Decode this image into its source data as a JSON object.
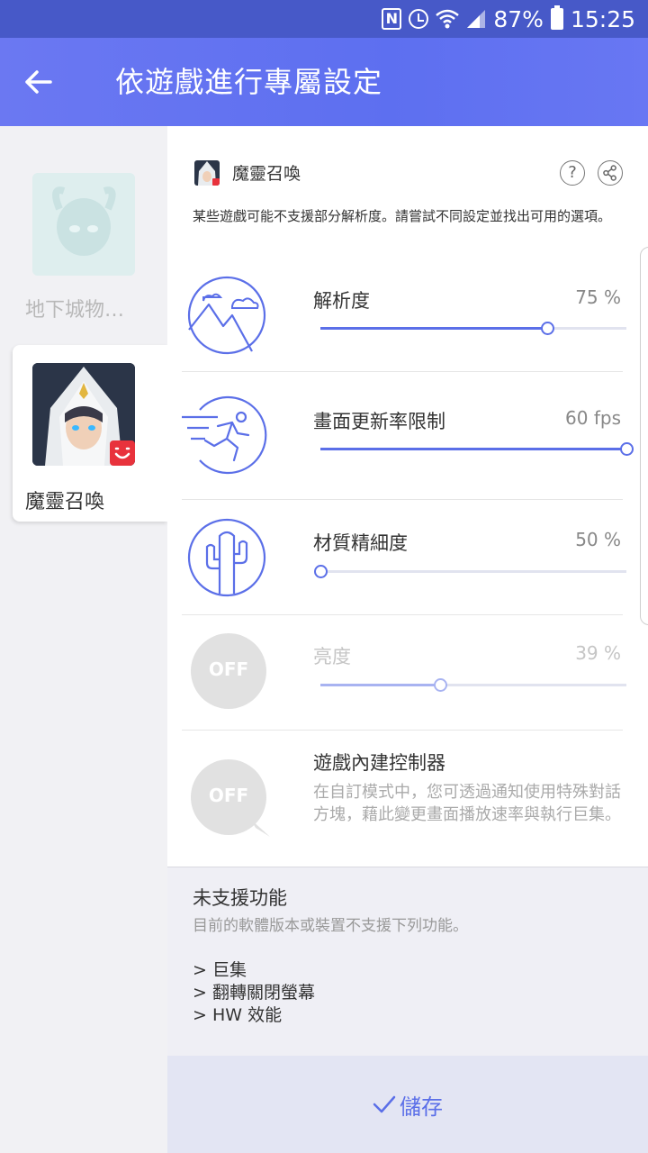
{
  "status_bar": {
    "nfc_icon": "N",
    "battery_percent": "87%",
    "time": "15:25"
  },
  "app_bar": {
    "title": "依遊戲進行專屬設定"
  },
  "games": [
    {
      "name": "地下城物…",
      "selected": false
    },
    {
      "name": "魔靈召喚",
      "selected": true
    }
  ],
  "game_header": {
    "name": "魔靈召喚",
    "help_icon": "?"
  },
  "notice": "某些遊戲可能不支援部分解析度。請嘗試不同設定並找出可用的選項。",
  "settings": [
    {
      "label": "解析度",
      "value": "75 %",
      "level": 0.74
    },
    {
      "label": "畫面更新率限制",
      "value": "60 fps",
      "level": 1.0
    },
    {
      "label": "材質精細度",
      "value": "50 %",
      "level": 0.0
    },
    {
      "label": "亮度",
      "value": "39 %",
      "level": 0.39,
      "enabled": false,
      "icon_text": "OFF"
    }
  ],
  "controller": {
    "label": "遊戲內建控制器",
    "icon_text": "OFF",
    "description": "在自訂模式中，您可透過通知使用特殊對話方塊，藉此變更畫面播放速率與執行巨集。"
  },
  "unsupported": {
    "title": "未支援功能",
    "subtitle": "目前的軟體版本或裝置不支援下列功能。",
    "items": [
      "> 巨集",
      "> 翻轉關閉螢幕",
      "> HW 效能"
    ]
  },
  "save": {
    "label": "儲存"
  },
  "colors": {
    "accent": "#5b6fe8",
    "appbar": "#6676f2",
    "statusbar": "#4759c8"
  }
}
